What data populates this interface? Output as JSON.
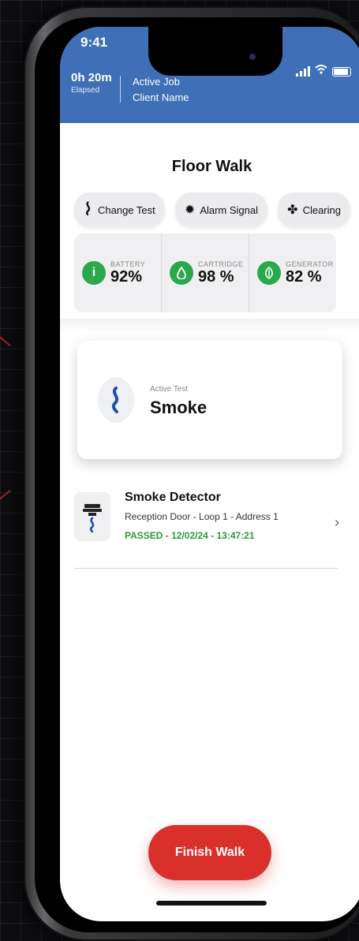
{
  "status_bar": {
    "time": "9:41"
  },
  "header": {
    "elapsed_value": "0h 20m",
    "elapsed_label": "Elapsed",
    "job_label": "Active Job",
    "client_name": "Client Name"
  },
  "page_title": "Floor Walk",
  "actions": {
    "change_test": "Change Test",
    "alarm_signal": "Alarm Signal",
    "clearing": "Clearing"
  },
  "stats": {
    "battery_label": "BATTERY",
    "battery_value": "92%",
    "cartridge_label": "CARTRIDGE",
    "cartridge_value": "98 %",
    "generator_label": "GENERATOR",
    "generator_value": "82 %"
  },
  "active_test": {
    "label": "Active Test",
    "value": "Smoke"
  },
  "device": {
    "name": "Smoke Detector",
    "location": "Reception Door - Loop 1 - Address 1",
    "result": "PASSED - 12/02/24 - 13:47:21"
  },
  "finish_button": "Finish Walk",
  "colors": {
    "header": "#3e6fb7",
    "accent_red": "#d9302b",
    "success_green": "#2aa84a",
    "smoke_blue": "#1e4fa6"
  },
  "icons": {
    "stat_battery": "i",
    "stat_cartridge": "drop",
    "stat_generator": "leaf"
  }
}
